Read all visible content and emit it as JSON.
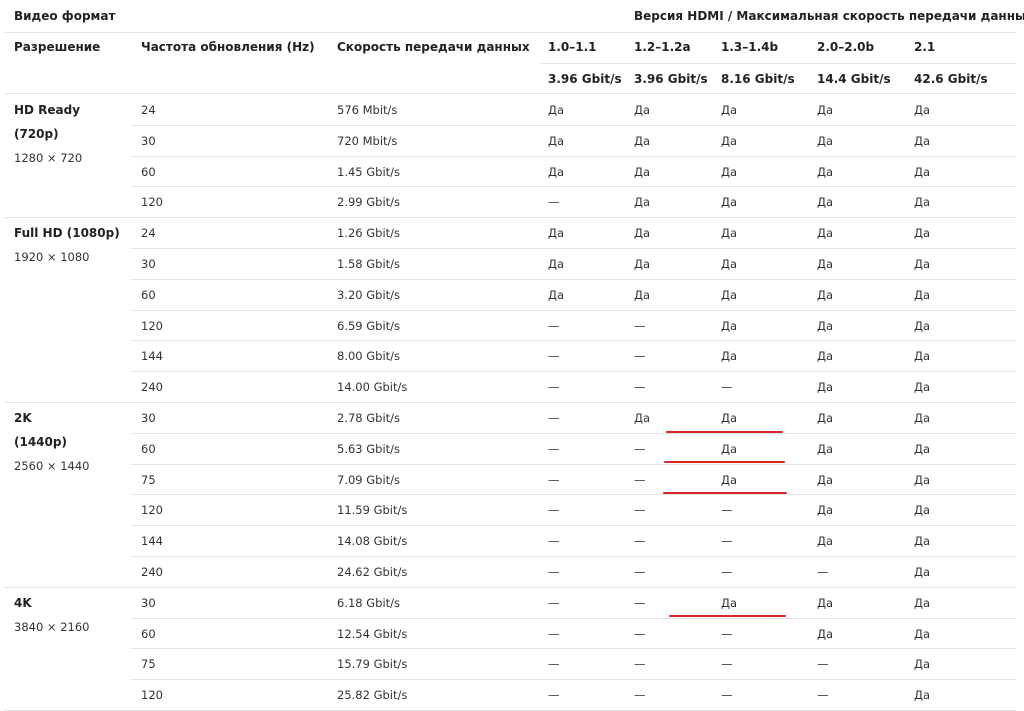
{
  "header": {
    "video_format": "Видео формат",
    "hdmi_title": "Версия HDMI / Максимальная скорость передачи данных",
    "resolution": "Разрешение",
    "refresh": "Частота обновления (Hz)",
    "speed": "Скорость передачи данных",
    "versions": [
      "1.0–1.1",
      "1.2–1.2a",
      "1.3–1.4b",
      "2.0–2.0b",
      "2.1"
    ],
    "max_rates": [
      "3.96 Gbit/s",
      "3.96 Gbit/s",
      "8.16 Gbit/s",
      "14.4 Gbit/s",
      "42.6 Gbit/s"
    ]
  },
  "groups": [
    {
      "name": "HD Ready",
      "sub": "(720p)",
      "res": "1280 × 720"
    },
    {
      "name": "Full HD (1080p)",
      "sub": "",
      "res": "1920 × 1080"
    },
    {
      "name": "2K",
      "sub": "(1440p)",
      "res": "2560 × 1440"
    },
    {
      "name": "4K",
      "sub": "",
      "res": "3840 × 2160"
    }
  ],
  "rows": [
    {
      "hz": "24",
      "rate": "576 Mbit/s",
      "s": [
        "Да",
        "Да",
        "Да",
        "Да",
        "Да"
      ]
    },
    {
      "hz": "30",
      "rate": "720 Mbit/s",
      "s": [
        "Да",
        "Да",
        "Да",
        "Да",
        "Да"
      ]
    },
    {
      "hz": "60",
      "rate": "1.45 Gbit/s",
      "s": [
        "Да",
        "Да",
        "Да",
        "Да",
        "Да"
      ]
    },
    {
      "hz": "120",
      "rate": "2.99 Gbit/s",
      "s": [
        "—",
        "Да",
        "Да",
        "Да",
        "Да"
      ]
    },
    {
      "hz": "24",
      "rate": "1.26 Gbit/s",
      "s": [
        "Да",
        "Да",
        "Да",
        "Да",
        "Да"
      ]
    },
    {
      "hz": "30",
      "rate": "1.58 Gbit/s",
      "s": [
        "Да",
        "Да",
        "Да",
        "Да",
        "Да"
      ]
    },
    {
      "hz": "60",
      "rate": "3.20 Gbit/s",
      "s": [
        "Да",
        "Да",
        "Да",
        "Да",
        "Да"
      ]
    },
    {
      "hz": "120",
      "rate": "6.59 Gbit/s",
      "s": [
        "—",
        "—",
        "Да",
        "Да",
        "Да"
      ]
    },
    {
      "hz": "144",
      "rate": "8.00 Gbit/s",
      "s": [
        "—",
        "—",
        "Да",
        "Да",
        "Да"
      ]
    },
    {
      "hz": "240",
      "rate": "14.00 Gbit/s",
      "s": [
        "—",
        "—",
        "—",
        "Да",
        "Да"
      ]
    },
    {
      "hz": "30",
      "rate": "2.78 Gbit/s",
      "s": [
        "—",
        "Да",
        "Да",
        "Да",
        "Да"
      ]
    },
    {
      "hz": "60",
      "rate": "5.63 Gbit/s",
      "s": [
        "—",
        "—",
        "Да",
        "Да",
        "Да"
      ]
    },
    {
      "hz": "75",
      "rate": "7.09 Gbit/s",
      "s": [
        "—",
        "—",
        "Да",
        "Да",
        "Да"
      ]
    },
    {
      "hz": "120",
      "rate": "11.59 Gbit/s",
      "s": [
        "—",
        "—",
        "—",
        "Да",
        "Да"
      ]
    },
    {
      "hz": "144",
      "rate": "14.08 Gbit/s",
      "s": [
        "—",
        "—",
        "—",
        "Да",
        "Да"
      ]
    },
    {
      "hz": "240",
      "rate": "24.62 Gbit/s",
      "s": [
        "—",
        "—",
        "—",
        "—",
        "Да"
      ]
    },
    {
      "hz": "30",
      "rate": "6.18 Gbit/s",
      "s": [
        "—",
        "—",
        "Да",
        "Да",
        "Да"
      ]
    },
    {
      "hz": "60",
      "rate": "12.54 Gbit/s",
      "s": [
        "—",
        "—",
        "—",
        "Да",
        "Да"
      ]
    },
    {
      "hz": "75",
      "rate": "15.79 Gbit/s",
      "s": [
        "—",
        "—",
        "—",
        "—",
        "Да"
      ]
    },
    {
      "hz": "120",
      "rate": "25.82 Gbit/s",
      "s": [
        "—",
        "—",
        "—",
        "—",
        "Да"
      ]
    }
  ],
  "annotation_color": "#d62828"
}
